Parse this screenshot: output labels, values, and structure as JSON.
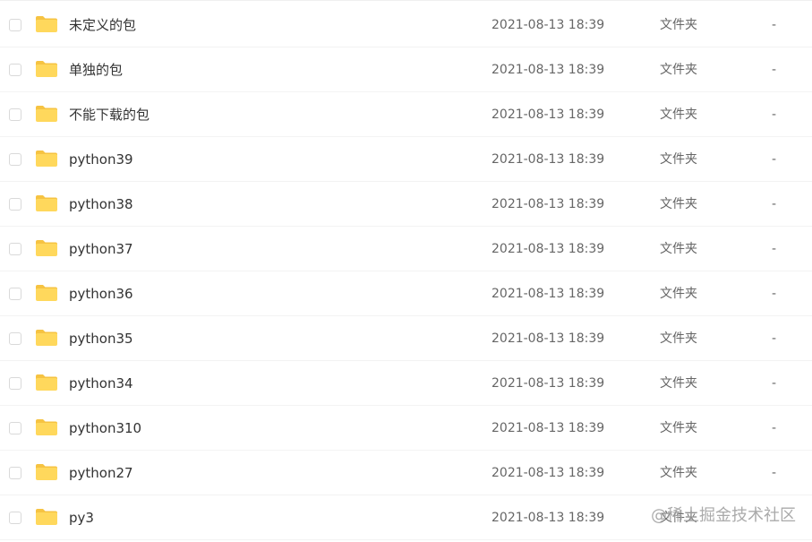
{
  "colors": {
    "folder_body": "#FFD85C",
    "folder_tab": "#F6C342",
    "row_border": "#f3f3f3",
    "text": "#333333",
    "meta_text": "#666666"
  },
  "files": [
    {
      "name": "未定义的包",
      "modified": "2021-08-13 18:39",
      "type": "文件夹",
      "size": "-",
      "icon": "folder-icon"
    },
    {
      "name": "单独的包",
      "modified": "2021-08-13 18:39",
      "type": "文件夹",
      "size": "-",
      "icon": "folder-icon"
    },
    {
      "name": "不能下载的包",
      "modified": "2021-08-13 18:39",
      "type": "文件夹",
      "size": "-",
      "icon": "folder-icon"
    },
    {
      "name": "python39",
      "modified": "2021-08-13 18:39",
      "type": "文件夹",
      "size": "-",
      "icon": "folder-icon"
    },
    {
      "name": "python38",
      "modified": "2021-08-13 18:39",
      "type": "文件夹",
      "size": "-",
      "icon": "folder-icon"
    },
    {
      "name": "python37",
      "modified": "2021-08-13 18:39",
      "type": "文件夹",
      "size": "-",
      "icon": "folder-icon"
    },
    {
      "name": "python36",
      "modified": "2021-08-13 18:39",
      "type": "文件夹",
      "size": "-",
      "icon": "folder-icon"
    },
    {
      "name": "python35",
      "modified": "2021-08-13 18:39",
      "type": "文件夹",
      "size": "-",
      "icon": "folder-icon"
    },
    {
      "name": "python34",
      "modified": "2021-08-13 18:39",
      "type": "文件夹",
      "size": "-",
      "icon": "folder-icon"
    },
    {
      "name": "python310",
      "modified": "2021-08-13 18:39",
      "type": "文件夹",
      "size": "-",
      "icon": "folder-icon"
    },
    {
      "name": "python27",
      "modified": "2021-08-13 18:39",
      "type": "文件夹",
      "size": "-",
      "icon": "folder-icon"
    },
    {
      "name": "py3",
      "modified": "2021-08-13 18:39",
      "type": "文件夹",
      "size": "",
      "icon": "folder-icon"
    }
  ],
  "watermark": "@稀土掘金技术社区"
}
